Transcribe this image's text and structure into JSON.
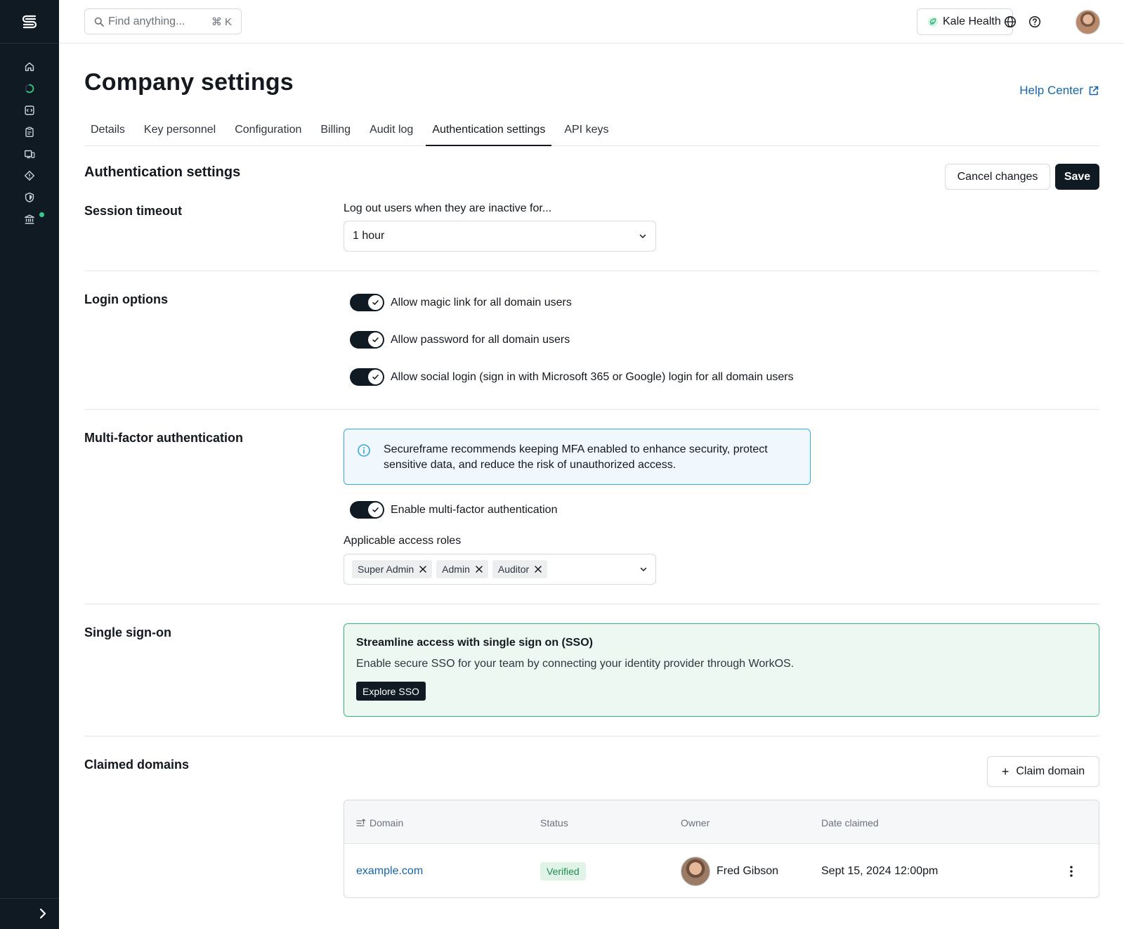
{
  "search": {
    "placeholder": "Find anything...",
    "shortcut": "⌘ K"
  },
  "org": {
    "name": "Kale Health"
  },
  "page": {
    "title": "Company settings",
    "help_link": "Help Center"
  },
  "tabs": [
    {
      "label": "Details"
    },
    {
      "label": "Key personnel"
    },
    {
      "label": "Configuration"
    },
    {
      "label": "Billing"
    },
    {
      "label": "Audit log"
    },
    {
      "label": "Authentication settings",
      "active": true
    },
    {
      "label": "API keys"
    }
  ],
  "section": {
    "title": "Authentication settings",
    "cancel_label": "Cancel changes",
    "save_label": "Save"
  },
  "session_timeout": {
    "label": "Session timeout",
    "field_label": "Log out users when they are inactive for...",
    "value": "1 hour"
  },
  "login_options": {
    "label": "Login options",
    "toggles": [
      {
        "label": "Allow magic link for all domain users",
        "on": true
      },
      {
        "label": "Allow password for all domain users",
        "on": true
      },
      {
        "label": "Allow social login (sign in with Microsoft 365 or Google) login for all domain users",
        "on": true
      }
    ]
  },
  "mfa": {
    "label": "Multi-factor authentication",
    "info_text": "Secureframe recommends keeping MFA enabled to enhance security, protect sensitive data, and reduce the risk of unauthorized access.",
    "toggle_label": "Enable multi-factor authentication",
    "toggle_on": true,
    "roles_label": "Applicable access roles",
    "roles": [
      "Super Admin",
      "Admin",
      "Auditor"
    ]
  },
  "sso": {
    "label": "Single sign-on",
    "title": "Streamline access with single sign on (SSO)",
    "description": "Enable secure SSO for your team by connecting your identity provider through WorkOS.",
    "button_label": "Explore SSO"
  },
  "domains": {
    "label": "Claimed domains",
    "claim_label": "Claim domain",
    "columns": [
      "Domain",
      "Status",
      "Owner",
      "Date claimed"
    ],
    "rows": [
      {
        "domain": "example.com",
        "status": "Verified",
        "owner": "Fred Gibson",
        "date": "Sept 15, 2024 12:00pm"
      }
    ]
  },
  "colors": {
    "sidebar": "#0f1a22",
    "accent_link": "#1864a8",
    "success": "#35b87f",
    "info": "#3aa8e0"
  }
}
